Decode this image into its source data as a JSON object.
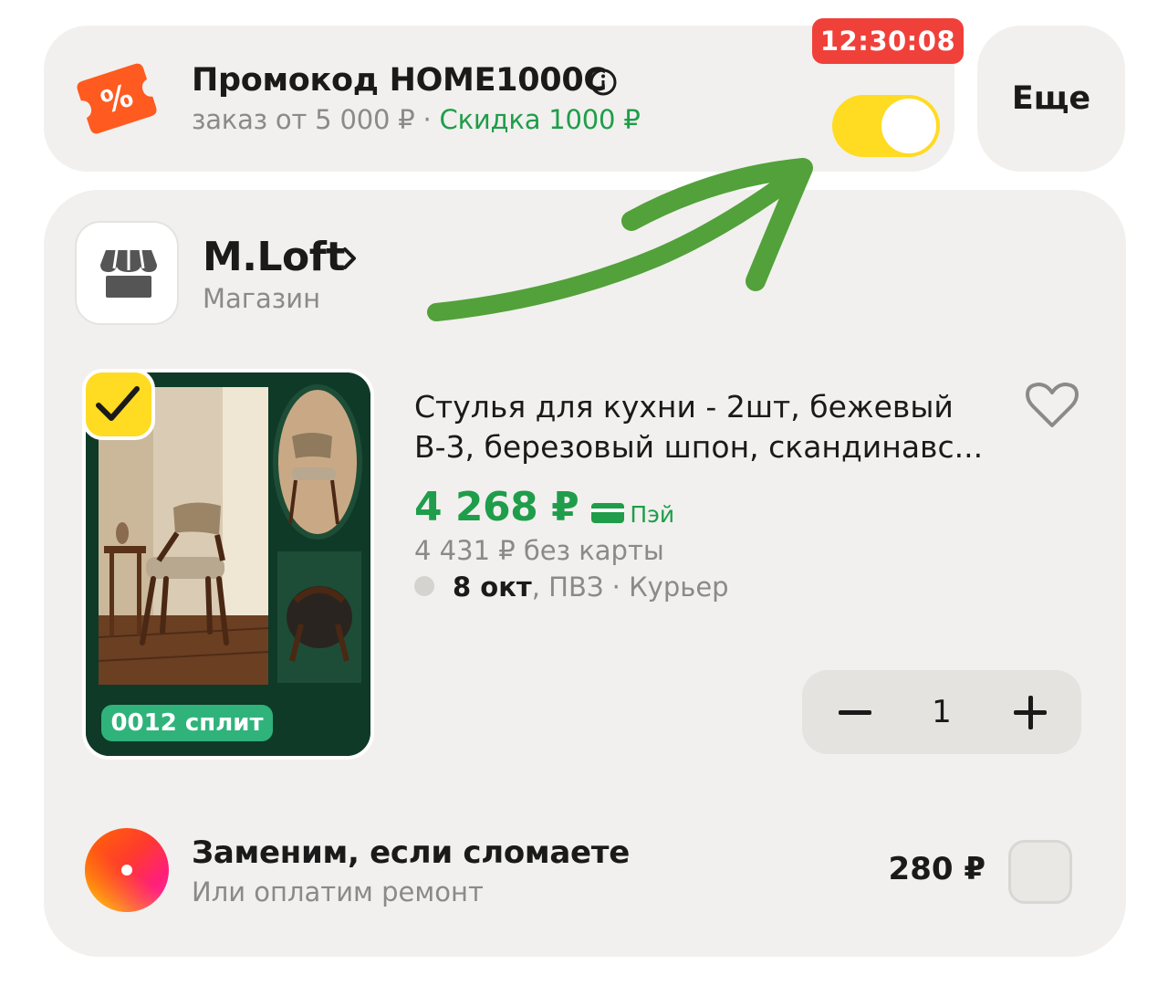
{
  "promo": {
    "title": "Промокод HOME1000C",
    "sub_grey": "заказ от 5 000 ₽ · ",
    "sub_green": "Скидка 1000 ₽",
    "timer": "12:30:08",
    "toggle_on": true,
    "colors": {
      "toggle": "#ffdb22",
      "timer": "#f0403a",
      "discount": "#1f9d4a",
      "icon": "#ff5a1f"
    }
  },
  "more": {
    "label": "Еще"
  },
  "store": {
    "name": "M.Loft",
    "type": "Магазин"
  },
  "product": {
    "title": "Стулья для кухни - 2шт, бежевый В-3, березовый шпон, скандинавс...",
    "price": "4 268 ₽",
    "pay_label": "Пэй",
    "price_without_card": "4 431 ₽ без карты",
    "delivery_date": "8 окт",
    "delivery_rest": ", ПВЗ · Курьер",
    "split_badge": "0012 сплит",
    "selected": true,
    "quantity": "1"
  },
  "insurance": {
    "title": "Заменим, если сломаете",
    "subtitle": "Или оплатим ремонт",
    "price": "280 ₽",
    "selected": false
  },
  "icons": [
    "promo-ticket-icon",
    "info-icon",
    "store-icon",
    "chevron-right-icon",
    "check-icon",
    "heart-icon",
    "card-icon",
    "minus-icon",
    "plus-icon",
    "insurance-logo-icon",
    "green-arrow-annotation"
  ]
}
